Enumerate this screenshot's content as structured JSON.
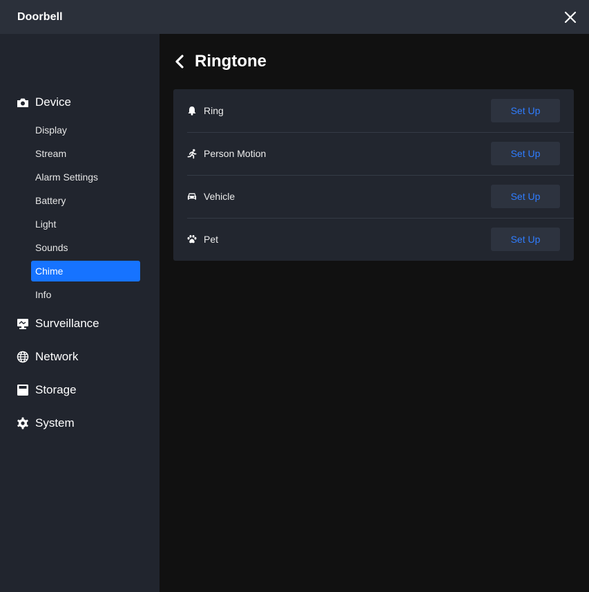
{
  "window": {
    "title": "Doorbell"
  },
  "sidebar": {
    "sections": [
      {
        "label": "Device",
        "icon": "camera-icon"
      },
      {
        "label": "Surveillance",
        "icon": "monitor-icon"
      },
      {
        "label": "Network",
        "icon": "globe-icon"
      },
      {
        "label": "Storage",
        "icon": "storage-icon"
      },
      {
        "label": "System",
        "icon": "gear-icon"
      }
    ],
    "device_items": [
      {
        "label": "Display"
      },
      {
        "label": "Stream"
      },
      {
        "label": "Alarm Settings"
      },
      {
        "label": "Battery"
      },
      {
        "label": "Light"
      },
      {
        "label": "Sounds"
      },
      {
        "label": "Chime",
        "active": true
      },
      {
        "label": "Info"
      }
    ]
  },
  "main": {
    "title": "Ringtone",
    "rows": [
      {
        "label": "Ring",
        "icon": "bell-icon",
        "button": "Set Up"
      },
      {
        "label": "Person Motion",
        "icon": "running-person-icon",
        "button": "Set Up"
      },
      {
        "label": "Vehicle",
        "icon": "car-icon",
        "button": "Set Up"
      },
      {
        "label": "Pet",
        "icon": "paw-icon",
        "button": "Set Up"
      }
    ]
  },
  "colors": {
    "titlebar": "#2b303a",
    "sidebar": "#21252e",
    "main_bg": "#111111",
    "card": "#22262f",
    "accent": "#1673ff",
    "button_text": "#2f7dff"
  }
}
